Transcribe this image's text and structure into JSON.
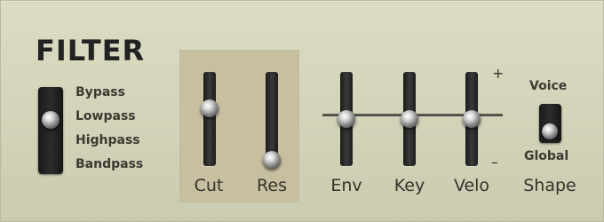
{
  "filter": {
    "title": "FILTER",
    "mode": {
      "options": [
        "Bypass",
        "Lowpass",
        "Highpass",
        "Bandpass"
      ],
      "selected": "Lowpass"
    },
    "sliders": {
      "cut": {
        "label": "Cut",
        "value": 0.63
      },
      "res": {
        "label": "Res",
        "value": 0.0
      },
      "env": {
        "label": "Env",
        "value": 0.5
      },
      "key": {
        "label": "Key",
        "value": 0.5
      },
      "velo": {
        "label": "Velo",
        "value": 0.5
      }
    },
    "bipolar": {
      "plus": "+",
      "minus": "–"
    },
    "shape": {
      "label": "Shape",
      "options": [
        "Voice",
        "Global"
      ],
      "selected": "Global"
    }
  }
}
